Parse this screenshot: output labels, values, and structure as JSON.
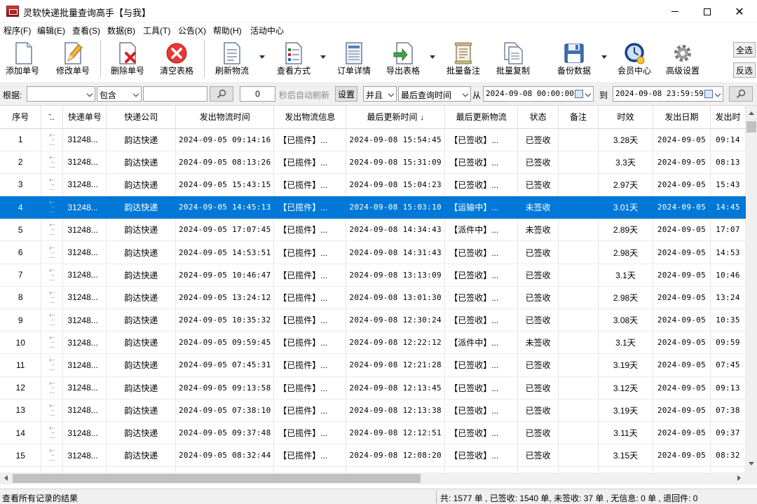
{
  "window": {
    "title": "灵软快递批量查询高手【与我】"
  },
  "menu": [
    "程序(F)",
    "编辑(E)",
    "查看(S)",
    "数据(B)",
    "工具(T)",
    "公告(X)",
    "帮助(H)",
    "活动中心"
  ],
  "toolbar": {
    "buttons": [
      {
        "label": "添加单号",
        "icon": "document-add-icon"
      },
      {
        "label": "修改单号",
        "icon": "document-edit-icon"
      },
      {
        "label": "删除单号",
        "icon": "document-delete-icon"
      },
      {
        "label": "清空表格",
        "icon": "clear-icon"
      },
      {
        "label": "刷新物流",
        "icon": "refresh-document-icon"
      },
      {
        "label": "查看方式",
        "icon": "view-mode-icon"
      },
      {
        "label": "订单详情",
        "icon": "order-detail-icon"
      },
      {
        "label": "导出表格",
        "icon": "export-icon"
      },
      {
        "label": "批量备注",
        "icon": "scroll-note-icon"
      },
      {
        "label": "批量复制",
        "icon": "copy-icon"
      },
      {
        "label": "备份数据",
        "icon": "floppy-icon"
      },
      {
        "label": "会员中心",
        "icon": "clock-member-icon"
      },
      {
        "label": "高级设置",
        "icon": "gear-icon"
      }
    ],
    "select_all": "全选",
    "invert_select": "反选"
  },
  "filter": {
    "basis_label": "根据:",
    "basis_value": "",
    "match_value": "包含",
    "keyword_value": "",
    "refresh_seconds": "0",
    "refresh_label": "秒后自动刷新",
    "settings_label": "设置",
    "logic_value": "并且",
    "field_value": "最后查询时间",
    "from_label": "从",
    "from_datetime": "2024-09-08 00:00:00",
    "to_label": "到",
    "to_datetime": "2024-09-08 23:59:59"
  },
  "table": {
    "columns": [
      "序号",
      "̄..",
      "快递单号",
      "快递公司",
      "发出物流时间",
      "发出物流信息",
      "最后更新时间",
      "最后更新物流",
      "状态",
      "备注",
      "时效",
      "发出日期",
      "发出时"
    ],
    "sort_indicator": "↓",
    "selected_row": 3,
    "rows": [
      [
        "1",
        "31248...",
        "韵达快递",
        "2024-09-05 09:14:16",
        "【已揽件】...",
        "2024-09-08 15:54:45",
        "【已签收】...",
        "已签收",
        "",
        "3.28天",
        "2024-09-05",
        "09:14"
      ],
      [
        "2",
        "31248...",
        "韵达快递",
        "2024-09-05 08:13:26",
        "【已揽件】...",
        "2024-09-08 15:31:09",
        "【已签收】...",
        "已签收",
        "",
        "3.3天",
        "2024-09-05",
        "08:13"
      ],
      [
        "3",
        "31248...",
        "韵达快递",
        "2024-09-05 15:43:15",
        "【已揽件】...",
        "2024-09-08 15:04:23",
        "【已签收】...",
        "已签收",
        "",
        "2.97天",
        "2024-09-05",
        "15:43"
      ],
      [
        "4",
        "31248...",
        "韵达快递",
        "2024-09-05 14:45:13",
        "【已揽件】...",
        "2024-09-08 15:03:10",
        "【运输中】...",
        "未签收",
        "",
        "3.01天",
        "2024-09-05",
        "14:45"
      ],
      [
        "5",
        "31248...",
        "韵达快递",
        "2024-09-05 17:07:45",
        "【已揽件】...",
        "2024-09-08 14:34:43",
        "【派件中】...",
        "未签收",
        "",
        "2.89天",
        "2024-09-05",
        "17:07"
      ],
      [
        "6",
        "31248...",
        "韵达快递",
        "2024-09-05 14:53:51",
        "【已揽件】...",
        "2024-09-08 14:31:43",
        "【已签收】...",
        "已签收",
        "",
        "2.98天",
        "2024-09-05",
        "14:53"
      ],
      [
        "7",
        "31248...",
        "韵达快递",
        "2024-09-05 10:46:47",
        "【已揽件】...",
        "2024-09-08 13:13:09",
        "【已签收】...",
        "已签收",
        "",
        "3.1天",
        "2024-09-05",
        "10:46"
      ],
      [
        "8",
        "31248...",
        "韵达快递",
        "2024-09-05 13:24:12",
        "【已揽件】...",
        "2024-09-08 13:01:30",
        "【已签收】...",
        "已签收",
        "",
        "2.98天",
        "2024-09-05",
        "13:24"
      ],
      [
        "9",
        "31248...",
        "韵达快递",
        "2024-09-05 10:35:32",
        "【已揽件】...",
        "2024-09-08 12:30:24",
        "【已签收】...",
        "已签收",
        "",
        "3.08天",
        "2024-09-05",
        "10:35"
      ],
      [
        "10",
        "31248...",
        "韵达快递",
        "2024-09-05 09:59:45",
        "【已揽件】...",
        "2024-09-08 12:22:12",
        "【派件中】...",
        "未签收",
        "",
        "3.1天",
        "2024-09-05",
        "09:59"
      ],
      [
        "11",
        "31248...",
        "韵达快递",
        "2024-09-05 07:45:31",
        "【已揽件】...",
        "2024-09-08 12:21:28",
        "【已签收】...",
        "已签收",
        "",
        "3.19天",
        "2024-09-05",
        "07:45"
      ],
      [
        "12",
        "31248...",
        "韵达快递",
        "2024-09-05 09:13:58",
        "【已揽件】...",
        "2024-09-08 12:13:45",
        "【已签收】...",
        "已签收",
        "",
        "3.12天",
        "2024-09-05",
        "09:13"
      ],
      [
        "13",
        "31248...",
        "韵达快递",
        "2024-09-05 07:38:10",
        "【已揽件】...",
        "2024-09-08 12:13:38",
        "【已签收】...",
        "已签收",
        "",
        "3.19天",
        "2024-09-05",
        "07:38"
      ],
      [
        "14",
        "31248...",
        "韵达快递",
        "2024-09-05 09:37:48",
        "【已揽件】...",
        "2024-09-08 12:12:51",
        "【已签收】...",
        "已签收",
        "",
        "3.11天",
        "2024-09-05",
        "09:37"
      ],
      [
        "15",
        "31248...",
        "韵达快递",
        "2024-09-05 08:32:44",
        "【已揽件】...",
        "2024-09-08 12:08:20",
        "【已签收】...",
        "已签收",
        "",
        "3.15天",
        "2024-09-05",
        "08:32"
      ]
    ]
  },
  "status": {
    "left": "查看所有记录的结果",
    "right": "共: 1577 单 , 已签收: 1540 单, 未签收: 37 单 , 无信息: 0 单 , 退回件: 0"
  },
  "colors": {
    "selection": "#0078d7",
    "app_icon": "#c62828"
  }
}
